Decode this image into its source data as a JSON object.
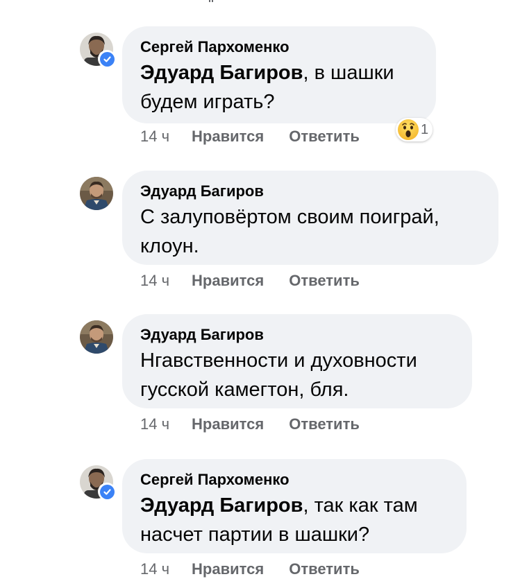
{
  "comments": [
    {
      "author": "Сергей Пархоменко",
      "mention": "Эдуард Багиров",
      "text_line1_rest": ", в шашки",
      "text_line2": "будем играть?",
      "time": "14 ч",
      "like": "Нравится",
      "reply": "Ответить",
      "verified": true,
      "reaction": {
        "icon": "wow-emoji-icon",
        "count": "1"
      }
    },
    {
      "author": "Эдуард Багиров",
      "text_line1": "С залуповёртом своим поиграй,",
      "text_line2": "клоун.",
      "time": "14 ч",
      "like": "Нравится",
      "reply": "Ответить",
      "verified": false
    },
    {
      "author": "Эдуард Багиров",
      "text_line1": "Нгавственности и духовности",
      "text_line2": "гусской камегтон, бля.",
      "time": "14 ч",
      "like": "Нравится",
      "reply": "Ответить",
      "verified": false
    },
    {
      "author": "Сергей Пархоменко",
      "mention": "Эдуард Багиров",
      "text_line1_rest": ", так как там",
      "text_line2": "насчет партии в шашки?",
      "time": "14 ч",
      "like": "Нравится",
      "reply": "Ответить",
      "verified": true
    }
  ],
  "colors": {
    "bubble": "#f0f2f5",
    "meta_text": "#65676b",
    "verified_badge": "#3b82f6"
  }
}
